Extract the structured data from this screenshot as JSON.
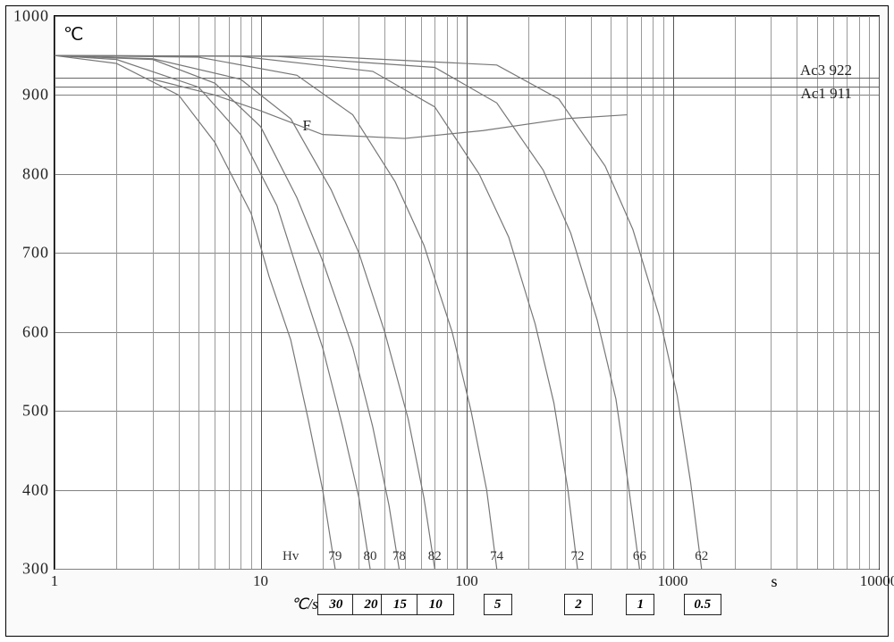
{
  "chart_data": {
    "type": "line",
    "title": "",
    "xlabel": "s",
    "ylabel": "℃",
    "xscale": "log10",
    "xlim": [
      1,
      10000
    ],
    "ylim": [
      300,
      1000
    ],
    "x_ticks": [
      1,
      10,
      100,
      1000,
      10000
    ],
    "y_ticks": [
      300,
      400,
      500,
      600,
      700,
      800,
      900,
      1000
    ],
    "phase_label": "F",
    "hardness_label": "Hv",
    "transformation_temps": {
      "Ac3": 922,
      "Ac1": 911
    },
    "hardness_Hv": {
      "30": 79,
      "20": 80,
      "15": 78,
      "10": 82,
      "5": 74,
      "2": 72,
      "1": 66,
      "0.5": 62
    },
    "series": [
      {
        "name": "30 ℃/s",
        "rate": 30,
        "x": [
          1,
          2,
          4,
          6,
          9,
          11,
          14,
          17,
          20,
          23
        ],
        "y": [
          950,
          940,
          900,
          840,
          750,
          670,
          590,
          490,
          400,
          300
        ]
      },
      {
        "name": "20 ℃/s",
        "rate": 20,
        "x": [
          1,
          2,
          5,
          8,
          12,
          15,
          20,
          25,
          30,
          34
        ],
        "y": [
          950,
          945,
          910,
          850,
          760,
          680,
          580,
          480,
          390,
          300
        ]
      },
      {
        "name": "15 ℃/s",
        "rate": 15,
        "x": [
          1,
          3,
          6,
          10,
          15,
          20,
          28,
          35,
          42,
          47
        ],
        "y": [
          950,
          945,
          915,
          860,
          770,
          690,
          580,
          480,
          380,
          300
        ]
      },
      {
        "name": "10 ℃/s",
        "rate": 10,
        "x": [
          1,
          3,
          8,
          14,
          22,
          30,
          40,
          52,
          62,
          70
        ],
        "y": [
          950,
          946,
          920,
          870,
          780,
          700,
          600,
          490,
          390,
          300
        ]
      },
      {
        "name": "5 ℃/s",
        "rate": 5,
        "x": [
          1,
          5,
          15,
          28,
          45,
          62,
          85,
          105,
          125,
          140
        ],
        "y": [
          950,
          948,
          925,
          875,
          790,
          710,
          600,
          500,
          400,
          300
        ]
      },
      {
        "name": "2 ℃/s",
        "rate": 2,
        "x": [
          1,
          8,
          35,
          70,
          115,
          160,
          215,
          265,
          310,
          345
        ],
        "y": [
          950,
          949,
          930,
          885,
          800,
          720,
          610,
          510,
          400,
          300
        ]
      },
      {
        "name": "1 ℃/s",
        "rate": 1,
        "x": [
          1,
          12,
          70,
          140,
          235,
          320,
          430,
          530,
          610,
          690
        ],
        "y": [
          950,
          949,
          935,
          890,
          805,
          725,
          615,
          515,
          405,
          300
        ]
      },
      {
        "name": "0.5 ℃/s",
        "rate": 0.5,
        "x": [
          1,
          20,
          140,
          280,
          470,
          640,
          860,
          1050,
          1220,
          1380
        ],
        "y": [
          950,
          949,
          938,
          895,
          810,
          730,
          620,
          520,
          410,
          300
        ]
      }
    ],
    "ferrite_start_curve": {
      "name": "F-start",
      "x": [
        3,
        6,
        10,
        20,
        50,
        120,
        300,
        600
      ],
      "y": [
        920,
        900,
        880,
        850,
        845,
        855,
        870,
        875
      ]
    },
    "cooling_rates_row": {
      "label": "℃/s",
      "rates": [
        30,
        20,
        15,
        10,
        5,
        2,
        1,
        0.5
      ]
    }
  }
}
